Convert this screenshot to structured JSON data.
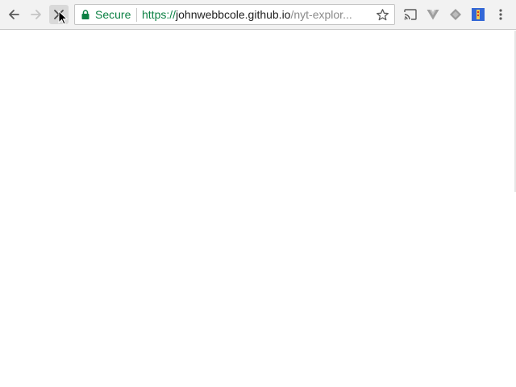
{
  "toolbar": {
    "back_icon": "back-arrow-icon",
    "forward_icon": "forward-arrow-icon",
    "stop_icon": "stop-x-icon"
  },
  "omnibox": {
    "security_label": "Secure",
    "url_scheme": "https://",
    "url_host": "johnwebbcole.github.io",
    "url_path": "/nyt-explor...",
    "lock_icon": "lock-icon",
    "bookmark_icon": "star-icon"
  },
  "extensions": {
    "cast_icon": "cast-icon",
    "vue_icon": "vue-devtools-icon",
    "diamond_icon": "diamond-extension-icon",
    "flag_icon": "flag-extension-icon",
    "menu_icon": "kebab-menu-icon"
  },
  "colors": {
    "secure_green": "#0b8043",
    "toolbar_bg": "#f2f2f2",
    "flag_blue": "#3367d6"
  }
}
